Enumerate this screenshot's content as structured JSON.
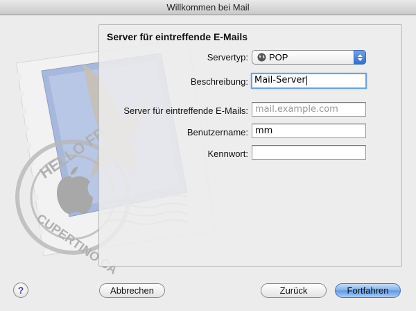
{
  "window": {
    "title": "Willkommen bei Mail"
  },
  "decor": {
    "stamp_text_top": "HELLO FR",
    "stamp_text_bottom": "CUPERTINO CA"
  },
  "panel": {
    "title": "Server für eintreffende E-Mails",
    "fields": {
      "server_type": {
        "label": "Servertyp:",
        "value": "POP",
        "icon": "globe-icon"
      },
      "description": {
        "label": "Beschreibung:",
        "value": "Mail-Server"
      },
      "incoming_server": {
        "label": "Server für eintreffende E-Mails:",
        "placeholder": "mail.example.com",
        "value": ""
      },
      "username": {
        "label": "Benutzername:",
        "value": "mm"
      },
      "password": {
        "label": "Kennwort:",
        "value": ""
      }
    }
  },
  "buttons": {
    "help": "?",
    "cancel": "Abbrechen",
    "back": "Zurück",
    "continue": "Fortfahren"
  },
  "colors": {
    "focus_ring": "#6fa2de",
    "default_button": "#5d98e2",
    "help_icon": "#5b3aa0"
  }
}
